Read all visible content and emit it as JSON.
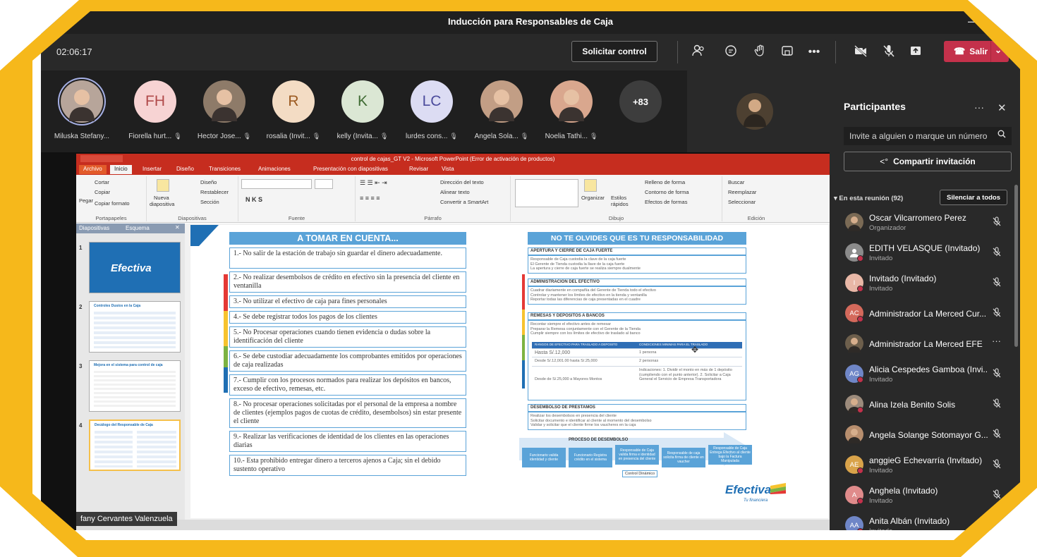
{
  "window": {
    "title": "Inducción para Responsables de Caja"
  },
  "controls": {
    "timer": "02:06:17",
    "request_control": "Solicitar control",
    "leave": "Salir"
  },
  "strip": [
    {
      "name": "Miluska Stefany...",
      "photo": true,
      "color": "#b7a59a",
      "muted": false
    },
    {
      "name": "Fiorella hurt...",
      "initials": "FH",
      "color": "#f7d3d3",
      "text": "#b04a4a",
      "muted": true
    },
    {
      "name": "Hector Jose...",
      "photo": true,
      "color": "#8e7b69",
      "muted": true
    },
    {
      "name": "rosalia (Invit...",
      "initials": "R",
      "color": "#f3dcc4",
      "text": "#9b5a21",
      "muted": true
    },
    {
      "name": "kelly (Invita...",
      "initials": "K",
      "color": "#dbe7d4",
      "text": "#3f6b33",
      "muted": true
    },
    {
      "name": "lurdes cons...",
      "initials": "LC",
      "color": "#dcdcf3",
      "text": "#4b4b9c",
      "muted": true
    },
    {
      "name": "Angela Sola...",
      "photo": true,
      "color": "#c29e85",
      "muted": true
    },
    {
      "name": "Noelia Tathi...",
      "photo": true,
      "color": "#d9a78e",
      "muted": true
    }
  ],
  "overflow_count": "+83",
  "ppt": {
    "title": "control de cajas_GT V2  -  Microsoft PowerPoint (Error de activación de productos)",
    "tabs": [
      "Archivo",
      "Inicio",
      "Insertar",
      "Diseño",
      "Transiciones",
      "Animaciones",
      "Presentación con diapositivas",
      "Revisar",
      "Vista"
    ],
    "ribbon": {
      "cortar": "Cortar",
      "copiar": "Copiar",
      "pegar": "Pegar",
      "copiar_formato": "Copiar formato",
      "portapapeles": "Portapapeles",
      "nueva": "Nueva",
      "diapositiva": "diapositiva",
      "diseno": "Diseño",
      "restablecer": "Restablecer",
      "seccion": "Sección",
      "diapositivas": "Diapositivas",
      "fuente": "Fuente",
      "parrafo": "Párrafo",
      "direccion": "Dirección del texto",
      "alinear": "Alinear texto",
      "convertir": "Convertir a SmartArt",
      "organizar": "Organizar",
      "estilos": "Estilos",
      "rapidos": "rápidos",
      "relleno": "Relleno de forma",
      "contorno": "Contorno de forma",
      "efectos": "Efectos de formas",
      "dibujo": "Dibujo",
      "buscar": "Buscar",
      "reemplazar": "Reemplazar",
      "seleccionar": "Seleccionar",
      "edicion": "Edición"
    },
    "pane_tabs": [
      "Diapositivas",
      "Esquema"
    ],
    "thumbs": [
      {
        "num": "1",
        "title": "Efectiva"
      },
      {
        "num": "2",
        "title": "Controles Dusíos en la Caja"
      },
      {
        "num": "3",
        "title": "Mejora en el sistema para control de caja"
      },
      {
        "num": "4",
        "title": "Decálogo del Responsable de Caja"
      }
    ]
  },
  "slide": {
    "left_header": "A TOMAR EN CUENTA...",
    "rules": [
      "1.- No salir de la estación de trabajo sin guardar el dinero adecuadamente.",
      "2.- No realizar desembolsos de crédito en efectivo sin la presencia del cliente en ventanilla",
      "3.- No utilizar el efectivo de caja para fines personales",
      "4.- Se debe registrar todos los pagos de los clientes",
      "5.- No Procesar operaciones cuando tienen evidencia o dudas sobre la identificación del cliente",
      "6.- Se debe custodiar adecuadamente los comprobantes emitidos por operaciones de caja realizadas",
      "7.- Cumplir con los procesos normados para realizar los depósitos en bancos, exceso de efectivo, remesas, etc.",
      "8.- No procesar operaciones solicitadas por el personal de la empresa a nombre de clientes (ejemplos pagos de cuotas de crédito, desembolsos) sin estar presente el cliente",
      "9.- Realizar las verificaciones de identidad de los clientes en las operaciones diarias",
      "10.- Esta prohibido entregar dinero a terceros ajenos a Caja; sin el debido sustento operativo"
    ],
    "right_header": "NO TE OLVIDES QUE ES TU RESPONSABILIDAD",
    "sections": [
      {
        "title": "APERTURA Y CIERRE DE CAJA FUERTE",
        "lines": [
          "Responsable de Caja custodia la clave de la caja fuerte",
          "El Gerente de Tienda custodia la llave de la caja fuerte",
          "La apertura y cierre de caja fuerte se realiza siempre dualmente"
        ]
      },
      {
        "title": "ADMINISTRACION DEL EFECTIVO",
        "lines": [
          "Cuadrar diariamente en compañía del Gerente de Tienda todo el efectivo",
          "Controlar y mantener los límites de efectivo en la tienda y ventanilla",
          "Reportar todas las diferencias de caja presentadas en el cuadre"
        ]
      },
      {
        "title": "REMESAS Y DEPOSITOS A BANCOS",
        "lines": [
          "Recontar siempre el efectivo antes de remesar",
          "Preparar la Remesa conjuntamente con el Gerente de la Tienda",
          "Cumplir siempre con los límites de efectivo de traslado al banco"
        ]
      },
      {
        "title": "DESEMBOLSO DE PRESTAMOS",
        "lines": [
          "Realizar los desembolsos en presencia del cliente",
          "Solicitar documento e identificar al cliente al momento del desembolso",
          "Validar y solicitar que el cliente firme los vaucheres en la caja"
        ]
      }
    ],
    "table": {
      "headers": [
        "RANGOS DE EFECTIVO PARA TRASLADO A DEPOSITO",
        "CONDICIONES MINIMAS PARA EL TRASLADO"
      ],
      "rows": [
        [
          "Hasta S/.12,000",
          "1 persona"
        ],
        [
          "Desde S/.12,001.00 hasta S/.25,000",
          "2 personas"
        ],
        [
          "Desde de S/.25,000 a Mayores Montos",
          "Indicaciones: 1. Dividir el monto en más de 1 depósito (cumpliendo con el punto anterior). 2. Solicitar a Caja General el Servicio de Empresa Transportadora"
        ]
      ]
    },
    "flow_title": "PROCESO DE DESEMBOLSO",
    "flow_steps": [
      "Funcionario valida identidad y cliente",
      "Funcionario Registra crédito en el sistema",
      "Responsable de Caja valida firma e identidad en presencia del cliente",
      "Responsable de caja solicita firma de cliente en vaucher",
      "Responsable de Caja Entrega Efectivo al cliente bajo la Factura Manipulada"
    ],
    "flow_control": "Control Dinámico",
    "brand": "Efectiva",
    "brand_tag": "Tu financiera"
  },
  "presenter_tag": "fany Cervantes Valenzuela",
  "panel": {
    "title": "Participantes",
    "invite_placeholder": "Invite a alguien o marque un número",
    "share_invite": "Compartir invitación",
    "in_meeting": "En esta reunión (92)",
    "mute_all": "Silenciar a todos",
    "people": [
      {
        "name": "Oscar Vilcarromero Perez",
        "role": "Organizador",
        "photo": true,
        "color": "#7a6a55",
        "dot": false,
        "mic": "muted"
      },
      {
        "name": "EDITH VELASQUE (Invitado)",
        "role": "Invitado",
        "initials": "",
        "color": "#8b8b8b",
        "dot": true,
        "mic": "muted"
      },
      {
        "name": "Invitado (Invitado)",
        "role": "Invitado",
        "initials": "I",
        "color": "#e8b7a6",
        "dot": true,
        "mic": "muted"
      },
      {
        "name": "Administrador La Merced Cur...",
        "role": "",
        "initials": "AC",
        "color": "#d4695b",
        "dot": true,
        "mic": "muted"
      },
      {
        "name": "Administrador La Merced EFE",
        "role": "",
        "photo": true,
        "color": "#6d5f4c",
        "dot": false,
        "mic": "more"
      },
      {
        "name": "Alicia Cespedes Gamboa (Invi...",
        "role": "Invitado",
        "initials": "AG",
        "color": "#6f86c7",
        "dot": true,
        "mic": "muted"
      },
      {
        "name": "Alina Izela Benito Solis",
        "role": "",
        "photo": true,
        "color": "#9c8b7c",
        "dot": true,
        "mic": "muted"
      },
      {
        "name": "Angela Solange Sotomayor G...",
        "role": "",
        "photo": true,
        "color": "#b78e6e",
        "dot": false,
        "mic": "muted"
      },
      {
        "name": "anggieG Echevarría (Invitado)",
        "role": "Invitado",
        "initials": "AE",
        "color": "#d9a34a",
        "dot": true,
        "mic": "muted"
      },
      {
        "name": "Anghela (Invitado)",
        "role": "Invitado",
        "initials": "A",
        "color": "#e08b8b",
        "dot": true,
        "mic": "muted"
      },
      {
        "name": "Anita Albán (Invitado)",
        "role": "Invitado",
        "initials": "AA",
        "color": "#6f86c7",
        "dot": true,
        "mic": "none"
      }
    ]
  },
  "colors": {
    "frame_yellow": "#f6b81b",
    "leave_red": "#c4314b",
    "slide_blue": "#5aa3d8",
    "ppt_red": "#c62d1f"
  }
}
